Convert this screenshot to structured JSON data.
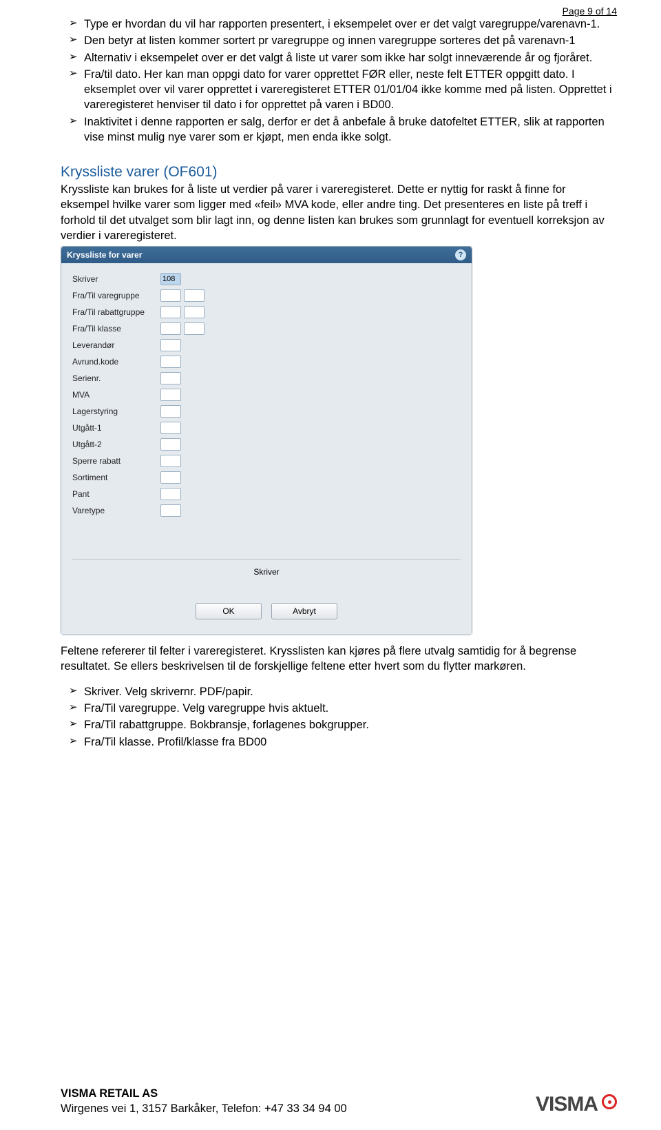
{
  "page_number": "Page 9 of 14",
  "intro_bullets": [
    "Type er hvordan du vil har rapporten presentert, i eksempelet over er det valgt varegruppe/varenavn-1.",
    "Den betyr at listen kommer sortert pr varegruppe og innen varegruppe sorteres det på varenavn-1",
    "Alternativ i eksempelet over er det valgt å liste ut varer som ikke har solgt inneværende år og fjoråret.",
    "Fra/til dato. Her kan man oppgi dato for varer opprettet FØR eller, neste felt ETTER oppgitt dato. I eksemplet over vil varer opprettet i vareregisteret ETTER 01/01/04 ikke komme med på listen. Opprettet i vareregisteret henviser til dato i for opprettet på varen i BD00.",
    "Inaktivitet i denne rapporten er salg, derfor er det å anbefale å bruke datofeltet ETTER, slik at rapporten vise minst mulig nye varer som er kjøpt, men enda ikke solgt."
  ],
  "section_title": "Kryssliste varer (OF601)",
  "section_intro": "Kryssliste kan brukes for å liste ut verdier på varer i vareregisteret. Dette er nyttig for raskt å finne for eksempel hvilke varer som ligger med «feil» MVA kode, eller andre ting. Det presenteres en liste på treff i forhold til det utvalget som blir lagt inn, og denne listen kan brukes som grunnlagt for eventuell korreksjon av verdier i vareregisteret.",
  "dialog": {
    "title": "Kryssliste for varer",
    "skriver_value": "108",
    "fields": [
      {
        "label": "Skriver",
        "inputs": 1,
        "first_blue": true
      },
      {
        "label": "Fra/Til varegruppe",
        "inputs": 2
      },
      {
        "label": "Fra/Til rabattgruppe",
        "inputs": 2
      },
      {
        "label": "Fra/Til klasse",
        "inputs": 2
      },
      {
        "label": "Leverandør",
        "inputs": 1
      },
      {
        "label": "Avrund.kode",
        "inputs": 1
      },
      {
        "label": "Serienr.",
        "inputs": 1
      },
      {
        "label": "MVA",
        "inputs": 1
      },
      {
        "label": "Lagerstyring",
        "inputs": 1
      },
      {
        "label": "Utgått-1",
        "inputs": 1
      },
      {
        "label": "Utgått-2",
        "inputs": 1
      },
      {
        "label": "Sperre rabatt",
        "inputs": 1
      },
      {
        "label": "Sortiment",
        "inputs": 1
      },
      {
        "label": "Pant",
        "inputs": 1
      },
      {
        "label": "Varetype",
        "inputs": 1
      }
    ],
    "print_label": "Skriver",
    "ok": "OK",
    "cancel": "Avbryt"
  },
  "after_dialog": "Feltene refererer til felter i vareregisteret. Krysslisten kan kjøres på flere utvalg samtidig for å begrense resultatet. Se ellers beskrivelsen til de forskjellige feltene etter hvert som du flytter markøren.",
  "end_bullets": [
    "Skriver. Velg skrivernr. PDF/papir.",
    "Fra/Til varegruppe. Velg varegruppe hvis aktuelt.",
    "Fra/Til rabattgruppe. Bokbransje, forlagenes bokgrupper.",
    "Fra/Til klasse. Profil/klasse fra BD00"
  ],
  "footer": {
    "company": "VISMA RETAIL AS",
    "address": "Wirgenes vei 1, 3157 Barkåker, Telefon: +47 33 34 94 00",
    "logo_text": "VISMA"
  }
}
